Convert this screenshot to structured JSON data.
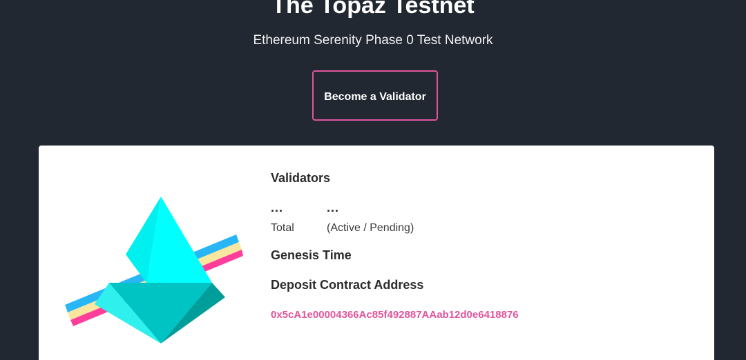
{
  "hero": {
    "title": "The Topaz Testnet",
    "subtitle": "Ethereum Serenity Phase 0 Test Network",
    "cta_label": "Become a Validator"
  },
  "card": {
    "logo_icon": "topaz-eth-diamond-icon",
    "validators": {
      "heading": "Validators",
      "total_value": "...",
      "total_label": "Total",
      "active_pending_value": "...",
      "active_pending_label": "(Active / Pending)"
    },
    "genesis": {
      "heading": "Genesis Time"
    },
    "deposit": {
      "heading": "Deposit Contract Address",
      "address": "0x5cA1e00004366Ac85f492887AAab12d0e6418876"
    }
  },
  "colors": {
    "background": "#222831",
    "card": "#ffffff",
    "accent_pink": "#e2549c",
    "stripe_blue": "#29b6f6",
    "stripe_yellow": "#f9e79f",
    "stripe_pink": "#ff3d9a",
    "diamond_cyan": "#00ffff",
    "diamond_teal": "#00c4c4",
    "diamond_dark_teal": "#009e9a"
  }
}
